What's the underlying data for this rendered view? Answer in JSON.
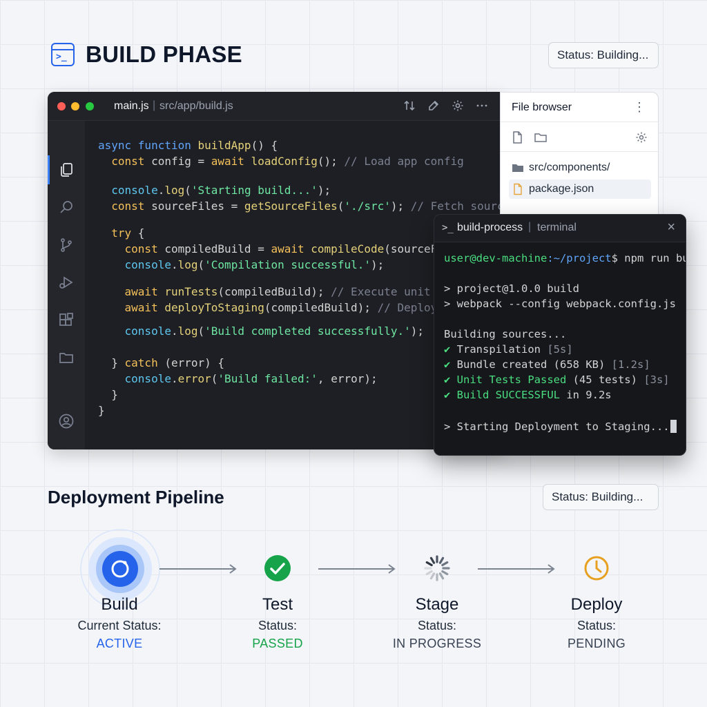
{
  "header": {
    "title": "BUILD PHASE",
    "status": "Status: Building..."
  },
  "editor": {
    "file": "main.js",
    "path": "src/app/build.js",
    "code": [
      [
        [
          "async ",
          "kw"
        ],
        [
          "function ",
          "kw"
        ],
        [
          "buildApp",
          "fn"
        ],
        [
          "() {",
          "pl"
        ]
      ],
      [
        [
          "  const ",
          "kw2"
        ],
        [
          "config = ",
          "pl"
        ],
        [
          "await ",
          "kw2"
        ],
        [
          "loadConfig",
          "fn"
        ],
        [
          "(); ",
          "pl"
        ],
        [
          "// Load app config",
          "cm"
        ]
      ],
      [
        [
          "  console",
          "obj"
        ],
        [
          ".",
          "pl"
        ],
        [
          "log",
          "fn"
        ],
        [
          "(",
          "pl"
        ],
        [
          "'Starting build...'",
          "str"
        ],
        [
          ");",
          "pl"
        ]
      ],
      [
        [
          "  const ",
          "kw2"
        ],
        [
          "sourceFiles = ",
          "pl"
        ],
        [
          "getSourceFiles",
          "fn"
        ],
        [
          "(",
          "pl"
        ],
        [
          "'./src'",
          "str"
        ],
        [
          "); ",
          "pl"
        ],
        [
          "// Fetch source files",
          "cm"
        ]
      ],
      [
        [
          "  try ",
          "kw2"
        ],
        [
          "{",
          "pl"
        ]
      ],
      [
        [
          "    const ",
          "kw2"
        ],
        [
          "compiledBuild = ",
          "pl"
        ],
        [
          "await ",
          "kw2"
        ],
        [
          "compileCode",
          "fn"
        ],
        [
          "(sourceFiles);",
          "pl"
        ]
      ],
      [
        [
          "    console",
          "obj"
        ],
        [
          ".",
          "pl"
        ],
        [
          "log",
          "fn"
        ],
        [
          "(",
          "pl"
        ],
        [
          "'Compilation successful.'",
          "str"
        ],
        [
          ");",
          "pl"
        ]
      ],
      [
        [
          "    await ",
          "kw2"
        ],
        [
          "runTests",
          "fn"
        ],
        [
          "(compiledBuild); ",
          "pl"
        ],
        [
          "// Execute unit tests",
          "cm"
        ]
      ],
      [
        [
          "    await ",
          "kw2"
        ],
        [
          "deployToStaging",
          "fn"
        ],
        [
          "(compiledBuild); ",
          "pl"
        ],
        [
          "// Deployment to",
          "cm"
        ]
      ],
      [
        [
          "    console",
          "obj"
        ],
        [
          ".",
          "pl"
        ],
        [
          "log",
          "fn"
        ],
        [
          "(",
          "pl"
        ],
        [
          "'Build completed successfully.'",
          "str"
        ],
        [
          ");",
          "pl"
        ]
      ],
      [
        [
          "  } ",
          "pl"
        ],
        [
          "catch ",
          "kw2"
        ],
        [
          "(error) {",
          "pl"
        ]
      ],
      [
        [
          "    console",
          "obj"
        ],
        [
          ".",
          "pl"
        ],
        [
          "error",
          "fn"
        ],
        [
          "(",
          "pl"
        ],
        [
          "'Build failed:'",
          "str"
        ],
        [
          ", error);",
          "pl"
        ]
      ],
      [
        [
          "  }",
          "pl"
        ]
      ],
      [
        [
          "}",
          "pl"
        ]
      ]
    ]
  },
  "file_browser": {
    "title": "File browser",
    "items": [
      {
        "name": "src/components/",
        "type": "folder",
        "selected": false
      },
      {
        "name": "package.json",
        "type": "file",
        "selected": true
      }
    ]
  },
  "terminal": {
    "name": "build-process",
    "kind": "terminal",
    "prompt_user": "user@dev-machine",
    "prompt_path": ":~/project",
    "prompt_cmd": "$ npm run build",
    "lines": [
      "> project@1.0.0 build",
      "> webpack --config webpack.config.js",
      "Building sources..."
    ],
    "checks": [
      {
        "text": "Transpilation",
        "detail": "[5s]",
        "green": false,
        "extra": ""
      },
      {
        "text": "Bundle created",
        "extra": " (658 KB)",
        "detail": "[1.2s]",
        "green": false
      },
      {
        "text": "Unit Tests Passed",
        "extra": " (45 tests)",
        "detail": "[3s]",
        "green": true
      },
      {
        "text": "Build SUCCESSFUL",
        "extra": " in 9.2s",
        "detail": "",
        "green": true
      }
    ],
    "final": "> Starting Deployment to Staging..."
  },
  "pipeline": {
    "title": "Deployment Pipeline",
    "status": "Status: Building...",
    "stages": [
      {
        "name": "Build",
        "label": "Current Status:",
        "value": "ACTIVE",
        "color": "#2563eb",
        "icon": "active-ring-icon"
      },
      {
        "name": "Test",
        "label": "Status:",
        "value": "PASSED",
        "color": "#16a34a",
        "icon": "check-circle-icon"
      },
      {
        "name": "Stage",
        "label": "Status:",
        "value": "IN PROGRESS",
        "color": "#374151",
        "icon": "spinner-icon"
      },
      {
        "name": "Deploy",
        "label": "Status:",
        "value": "PENDING",
        "color": "#374151",
        "icon": "clock-icon"
      }
    ]
  }
}
